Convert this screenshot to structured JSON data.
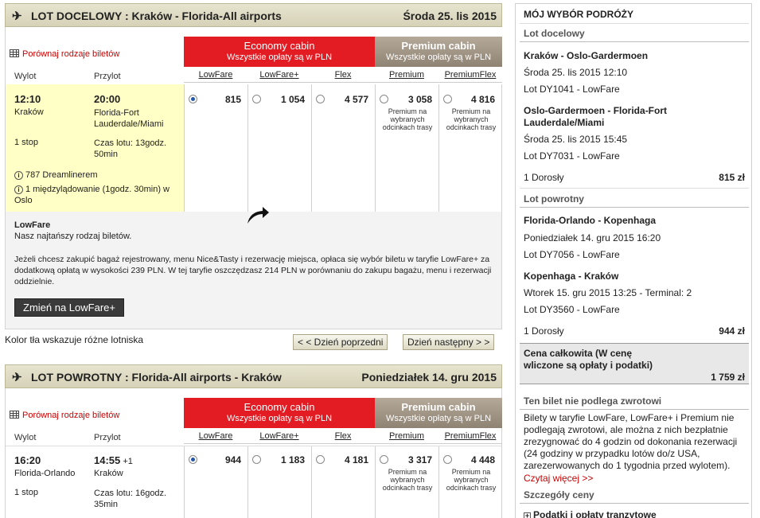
{
  "outbound": {
    "header_title": "LOT DOCELOWY :  Kraków - Florida-All airports",
    "header_date": "Środa 25. lis 2015",
    "compare_link": "Porównaj rodzaje biletów",
    "col_depart": "Wylot",
    "col_arrive": "Przylot",
    "depart_time": "12:10",
    "depart_city": "Kraków",
    "arrive_time": "20:00",
    "arrive_city": "Florida-Fort Lauderdale/Miami",
    "stops": "1 stop",
    "duration": "Czas lotu: 13godz. 50min",
    "aircraft": "787 Dreamlinerem",
    "stopover": "1 międzylądowanie (1godz. 30min) w Oslo",
    "fares": [
      {
        "price": "815",
        "selected": true,
        "note": ""
      },
      {
        "price": "1 054",
        "selected": false,
        "note": ""
      },
      {
        "price": "4 577",
        "selected": false,
        "note": ""
      },
      {
        "price": "3 058",
        "selected": false,
        "note": "Premium na wybranych odcinkach trasy"
      },
      {
        "price": "4 816",
        "selected": false,
        "note": "Premium na wybranych odcinkach trasy"
      }
    ],
    "fare_title": "LowFare",
    "fare_desc1": "Nasz najtańszy rodzaj biletów.",
    "fare_desc2": "Jeżeli chcesz zakupić bagaż rejestrowany, menu Nice&Tasty i rezerwację miejsca, opłaca się wybór biletu w taryfie LowFare+ za dodatkową opłatą w wysokości 239 PLN. W tej taryfie oszczędzasz 214 PLN w porównaniu do zakupu bagażu, menu i rezerwacji oddzielnie.",
    "change_button": "Zmień na LowFare+"
  },
  "cabins": {
    "economy_name": "Economy cabin",
    "economy_note": "Wszystkie opłaty są w PLN",
    "premium_name": "Premium cabin",
    "premium_note": "Wszystkie opłaty są w PLN"
  },
  "fare_types": [
    "LowFare",
    "LowFare+",
    "Flex",
    "Premium",
    "PremiumFlex"
  ],
  "nav": {
    "legend": "Kolor tła wskazuje różne lotniska",
    "prev_day": "< < Dzień poprzedni",
    "next_day": "Dzień następny > >"
  },
  "inbound": {
    "header_title": "LOT POWROTNY :  Florida-All airports - Kraków",
    "header_date": "Poniedziałek 14. gru 2015",
    "compare_link": "Porównaj rodzaje biletów",
    "col_depart": "Wylot",
    "col_arrive": "Przylot",
    "depart_time": "16:20",
    "depart_city": "Florida-Orlando",
    "arrive_time": "14:55",
    "arrive_plus": "+1",
    "arrive_city": "Kraków",
    "stops": "1 stop",
    "duration": "Czas lotu: 16godz. 35min",
    "fares": [
      {
        "price": "944",
        "selected": true,
        "note": ""
      },
      {
        "price": "1 183",
        "selected": false,
        "note": ""
      },
      {
        "price": "4 181",
        "selected": false,
        "note": ""
      },
      {
        "price": "3 317",
        "selected": false,
        "note": "Premium na wybranych odcinkach trasy"
      },
      {
        "price": "4 448",
        "selected": false,
        "note": "Premium na wybranych odcinkach trasy"
      }
    ]
  },
  "sidebar": {
    "title": "MÓJ WYBÓR PODRÓŻY",
    "outbound_label": "Lot docelowy",
    "seg1_route": "Kraków - Oslo-Gardermoen",
    "seg1_time": "Środa 25. lis 2015 12:10",
    "seg1_flight": "Lot DY1041 - LowFare",
    "seg2_route": "Oslo-Gardermoen - Florida-Fort Lauderdale/Miami",
    "seg2_time": "Środa 25. lis 2015 15:45",
    "seg2_flight": "Lot DY7031 - LowFare",
    "out_pax": "1 Dorosły",
    "out_price": "815 zł",
    "return_label": "Lot powrotny",
    "seg3_route": "Florida-Orlando - Kopenhaga",
    "seg3_time": "Poniedziałek 14. gru 2015 16:20",
    "seg3_flight": "Lot DY7056 - LowFare",
    "seg4_route": "Kopenhaga - Kraków",
    "seg4_time": "Wtorek 15. gru 2015 13:25 - Terminal: 2",
    "seg4_flight": "Lot DY3560 - LowFare",
    "ret_pax": "1 Dorosły",
    "ret_price": "944 zł",
    "total_label": "Cena całkowita (W cenę wliczone są opłaty i podatki)",
    "total_price": "1 759 zł",
    "nonrefund_title": "Ten bilet nie podlega zwrotowi",
    "nonrefund_text": "Bilety w taryfie LowFare, LowFare+ i Premium nie podlegają zwrotowi, ale można z nich bezpłatnie zrezygnować do 4 godzin od dokonania rezerwacji (24 godziny w przypadku lotów do/z USA, zarezerwowanych do 1 tygodnia przed wylotem).",
    "read_more": "Czytaj więcej >>",
    "price_details": "Szczegóły ceny",
    "taxes": "Podatki i opłaty tranzytowe"
  },
  "colors": {
    "economy": "#e31c23",
    "premium": "#a0968a",
    "highlight": "#ffffc6",
    "header_bg": "#dcd8c0",
    "link_red": "#cc0000"
  }
}
